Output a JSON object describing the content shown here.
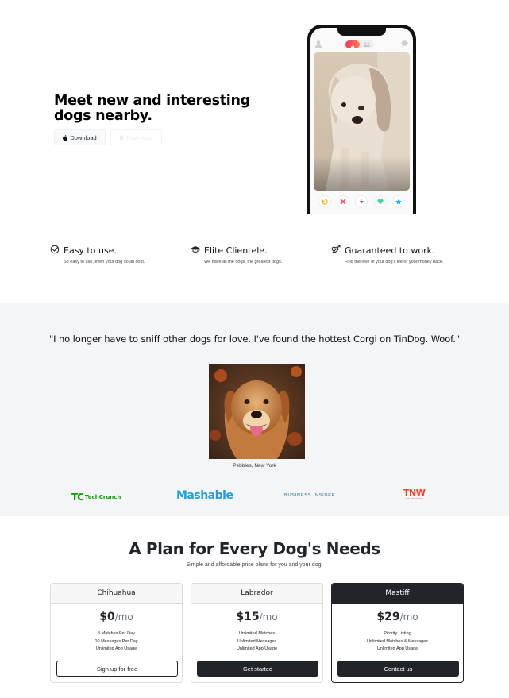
{
  "hero": {
    "title": "Meet new and interesting dogs nearby.",
    "download_label": "Download",
    "download2_label": "Download"
  },
  "features": [
    {
      "icon": "check-circle-icon",
      "title": "Easy to use.",
      "text": "So easy to use, even your dog could do it."
    },
    {
      "icon": "graduation-cap-icon",
      "title": "Elite Clientele.",
      "text": "We have all the dogs, the greatest dogs."
    },
    {
      "icon": "heart-arrow-icon",
      "title": "Guaranteed to work.",
      "text": "Find the love of your dog's life or your money back."
    }
  ],
  "testimonial": {
    "quote": "\"I no longer have to sniff other dogs for love. I've found the hottest Corgi on TinDog. Woof.\"",
    "caption": "Pebbles, New York"
  },
  "press": {
    "techcrunch_mark": "TC",
    "techcrunch": "TechCrunch",
    "mashable": "Mashable",
    "business_insider": "BUSINESS INSIDER",
    "tnw": "TNW",
    "tnw_sub": "THE NEXT WEB"
  },
  "pricing": {
    "title": "A Plan for Every Dog's Needs",
    "subtitle": "Simple and affordable price plans for you and your dog.",
    "plans": [
      {
        "name": "Chihuahua",
        "price": "$0",
        "per": "/mo",
        "features": [
          "5 Matches Per Day",
          "10 Messages Per Day",
          "Unlimited App Usage"
        ],
        "button": "Sign up for free"
      },
      {
        "name": "Labrador",
        "price": "$15",
        "per": "/mo",
        "features": [
          "Unlimited Matches",
          "Unlimited Messages",
          "Unlimited App Usage"
        ],
        "button": "Get started"
      },
      {
        "name": "Mastiff",
        "price": "$29",
        "per": "/mo",
        "features": [
          "Pirority Listing",
          "Unlimited Matches & Messages",
          "Unlimited App Usage"
        ],
        "button": "Contact us"
      }
    ]
  },
  "colors": {
    "dark": "#212529",
    "section_bg": "#f4f5f7",
    "tinder_gradient_start": "#f6385f",
    "tinder_gradient_end": "#ff7a50"
  }
}
